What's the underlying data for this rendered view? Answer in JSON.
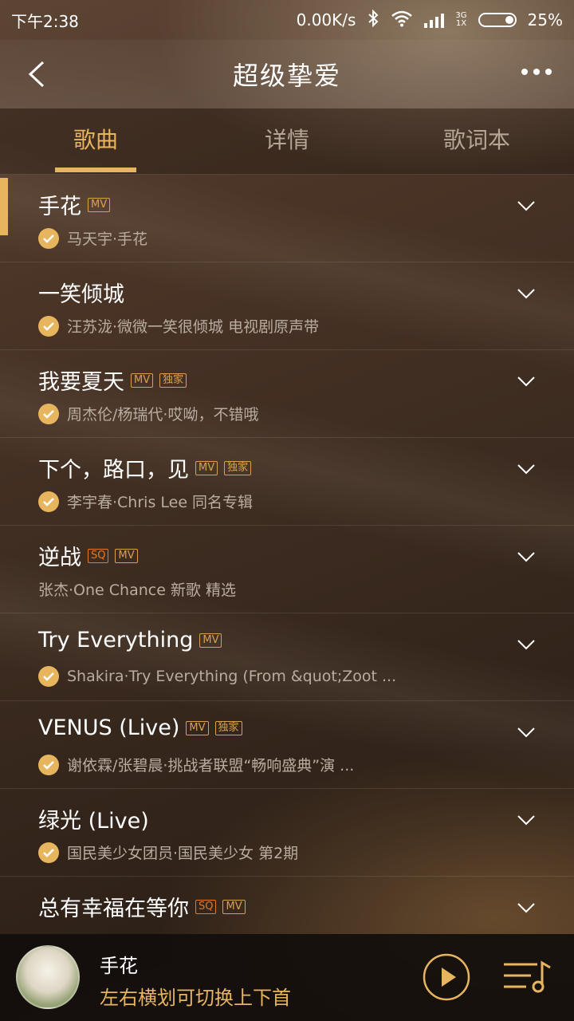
{
  "status_bar": {
    "time": "下午2:38",
    "net_speed": "0.00K/s",
    "network_type_top": "3G",
    "network_type_bottom": "1X",
    "battery": "25%"
  },
  "header": {
    "title": "超级挚爱"
  },
  "tabs": [
    {
      "label": "歌曲",
      "active": true
    },
    {
      "label": "详情",
      "active": false
    },
    {
      "label": "歌词本",
      "active": false
    }
  ],
  "songs": [
    {
      "title": "手花",
      "tags": [
        "MV"
      ],
      "downloaded": true,
      "subtitle": "马天宇·手花",
      "playing": true
    },
    {
      "title": "一笑倾城",
      "tags": [],
      "downloaded": true,
      "subtitle": "汪苏泷·微微一笑很倾城 电视剧原声带"
    },
    {
      "title": "我要夏天",
      "tags": [
        "MV",
        "独家"
      ],
      "downloaded": true,
      "subtitle": "周杰伦/杨瑞代·哎呦，不错哦"
    },
    {
      "title": "下个，路口，见",
      "tags": [
        "MV",
        "独家"
      ],
      "downloaded": true,
      "subtitle": "李宇春·Chris Lee 同名专辑"
    },
    {
      "title": "逆战",
      "tags": [
        "SQ",
        "MV"
      ],
      "downloaded": false,
      "subtitle": "张杰·One Chance 新歌 精选"
    },
    {
      "title": "Try Everything",
      "tags": [
        "MV"
      ],
      "downloaded": true,
      "subtitle": "Shakira·Try Everything (From &quot;Zoot ..."
    },
    {
      "title": "VENUS (Live)",
      "tags": [
        "MV",
        "独家"
      ],
      "downloaded": true,
      "subtitle": "谢依霖/张碧晨·挑战者联盟“畅响盛典”演 ..."
    },
    {
      "title": "绿光 (Live)",
      "tags": [],
      "downloaded": true,
      "subtitle": "国民美少女团员·国民美少女 第2期"
    },
    {
      "title": "总有幸福在等你",
      "tags": [
        "SQ",
        "MV"
      ],
      "downloaded": false,
      "subtitle": ""
    }
  ],
  "player": {
    "now_playing_title": "手花",
    "hint": "左右横划可切换上下首"
  },
  "colors": {
    "accent": "#e8b55f",
    "sq_tag": "#e07a2a"
  },
  "icons": [
    "back-icon",
    "more-icon",
    "chevron-down-icon",
    "check-icon",
    "play-icon",
    "playlist-icon",
    "bluetooth-icon",
    "wifi-icon"
  ]
}
